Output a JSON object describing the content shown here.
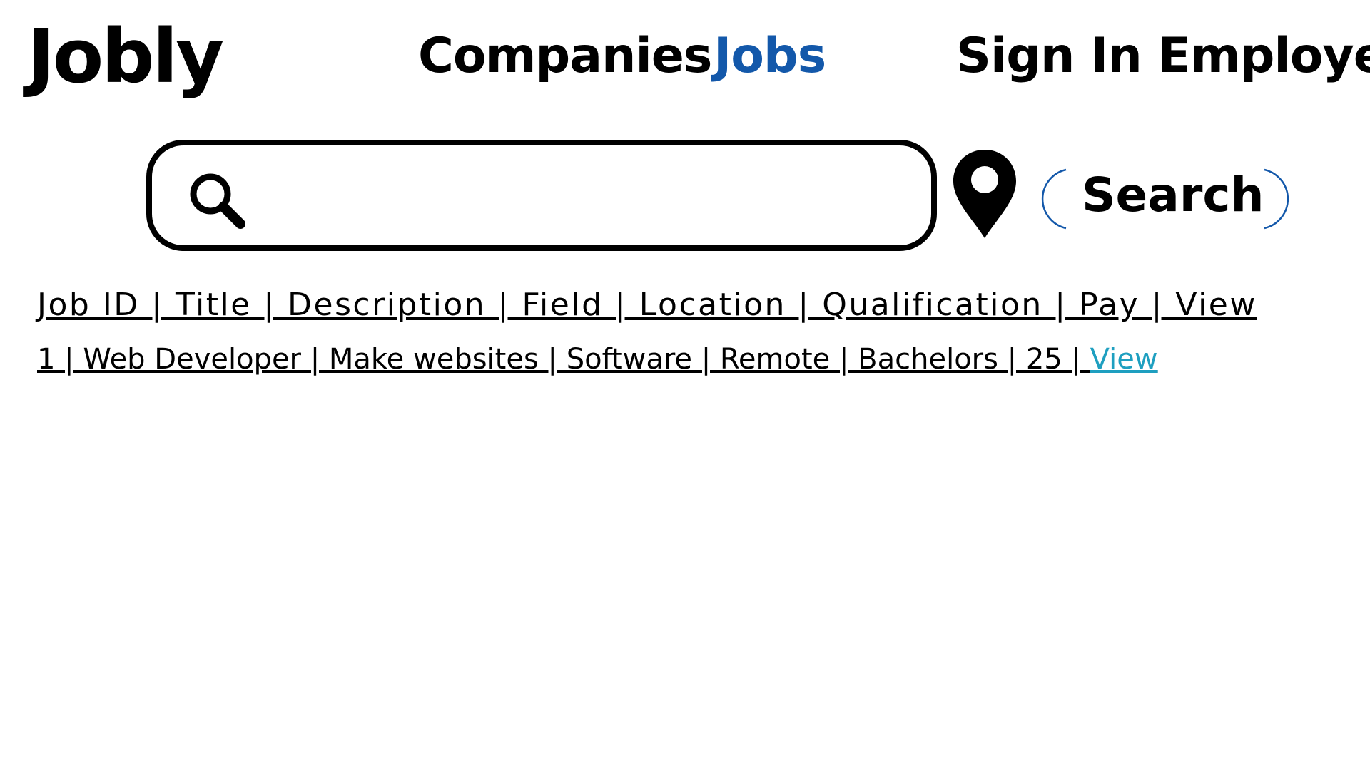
{
  "app": {
    "logo": "Jobly"
  },
  "nav": {
    "companies": "Companies",
    "jobs": "Jobs",
    "signin": "Sign In Employer"
  },
  "search": {
    "value": "",
    "placeholder": "",
    "button_label": "Search"
  },
  "table": {
    "columns": [
      "Job ID",
      "Title",
      "Description",
      "Field",
      "Location",
      "Qualification",
      "Pay",
      "View"
    ],
    "header_line": "Job ID | Title | Description | Field | Location | Qualification | Pay | View",
    "rows": [
      {
        "job_id": "1",
        "title": "Web Developer",
        "description": "Make websites",
        "field": "Software",
        "location": "Remote",
        "qualification": "Bachelors",
        "pay": "25",
        "view": "View",
        "line_text": "1 | Web Developer | Make websites | Software | Remote | Bachelors | 25 | "
      }
    ]
  },
  "icons": {
    "search": "search-icon",
    "location": "location-pin-icon"
  },
  "colors": {
    "accent": "#1358aa",
    "link": "#1e9fc0",
    "text": "#000000"
  }
}
